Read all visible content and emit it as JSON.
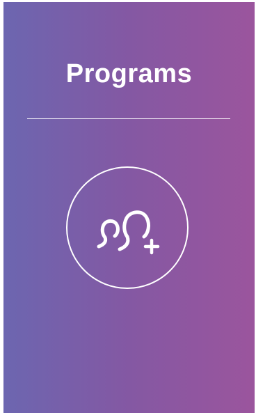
{
  "card": {
    "title": "Programs",
    "icon": "add-users-icon"
  }
}
